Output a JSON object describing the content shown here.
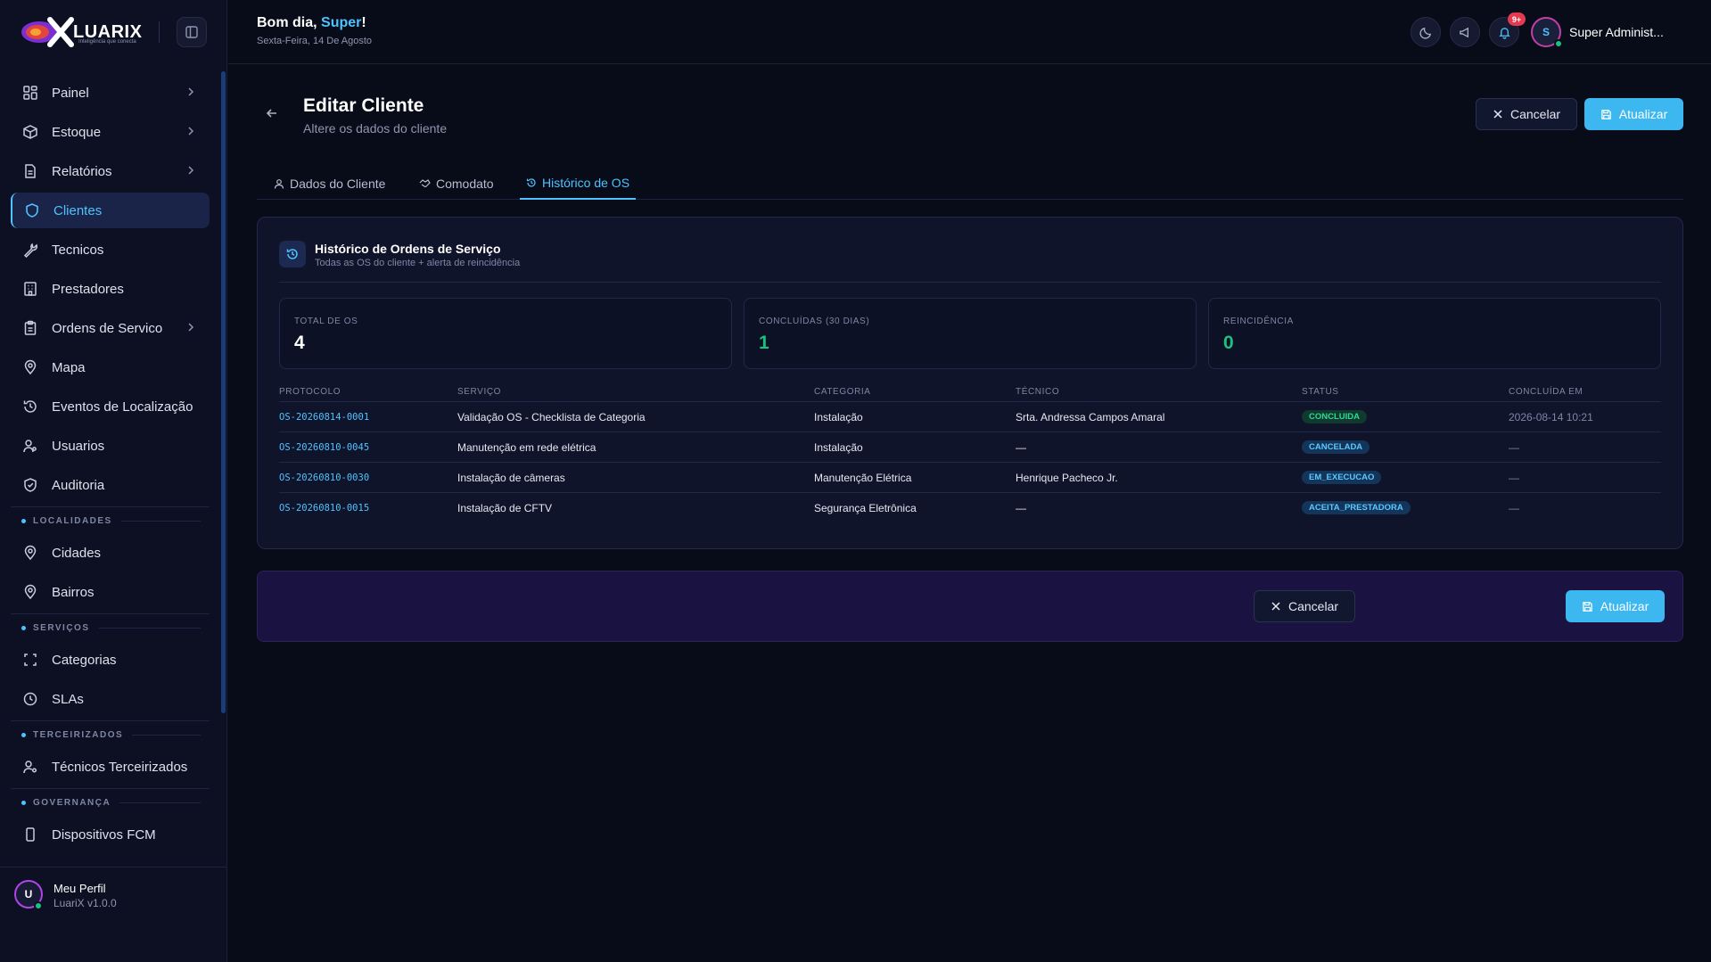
{
  "brand": {
    "logo_text": "LUARIX",
    "tagline": "Inteligência que conecta",
    "accent": "#4ec3ff"
  },
  "sidebar": {
    "items": [
      {
        "label": "Painel",
        "icon": "grid-icon",
        "chevron": true
      },
      {
        "label": "Estoque",
        "icon": "box-icon",
        "chevron": true
      },
      {
        "label": "Relatórios",
        "icon": "report-icon",
        "chevron": true
      },
      {
        "label": "Clientes",
        "icon": "shield-icon",
        "active": true
      },
      {
        "label": "Tecnicos",
        "icon": "wrench-icon"
      },
      {
        "label": "Prestadores",
        "icon": "building-icon"
      },
      {
        "label": "Ordens de Servico",
        "icon": "clipboard-icon",
        "chevron": true
      },
      {
        "label": "Mapa",
        "icon": "map-pin-icon"
      },
      {
        "label": "Eventos de Localização",
        "icon": "history-icon"
      },
      {
        "label": "Usuarios",
        "icon": "users-icon"
      },
      {
        "label": "Auditoria",
        "icon": "shield-check-icon"
      }
    ],
    "sections": [
      {
        "title": "LOCALIDADES",
        "items": [
          {
            "label": "Cidades",
            "icon": "map-pin-icon"
          },
          {
            "label": "Bairros",
            "icon": "map-pin-icon"
          }
        ]
      },
      {
        "title": "SERVIÇOS",
        "items": [
          {
            "label": "Categorias",
            "icon": "scan-icon"
          },
          {
            "label": "SLAs",
            "icon": "clock-icon"
          }
        ]
      },
      {
        "title": "TERCEIRIZADOS",
        "items": [
          {
            "label": "Técnicos Terceirizados",
            "icon": "user-cog-icon"
          }
        ]
      },
      {
        "title": "GOVERNANÇA",
        "items": [
          {
            "label": "Dispositivos FCM",
            "icon": "phone-icon"
          }
        ]
      }
    ],
    "profile": {
      "initial": "U",
      "name": "Meu Perfil",
      "version": "LuariX v1.0.0"
    }
  },
  "header": {
    "greeting_prefix": "Bom dia, ",
    "greeting_name": "Super",
    "greeting_suffix": "!",
    "date": "Sexta-Feira, 14 De Agosto",
    "notif_count": "9+",
    "user_initial": "S",
    "user_name": "Super Administ..."
  },
  "page": {
    "title": "Editar Cliente",
    "subtitle": "Altere os dados do cliente",
    "cancel_label": "Cancelar",
    "update_label": "Atualizar",
    "tabs": [
      {
        "label": "Dados do Cliente",
        "icon": "user-icon"
      },
      {
        "label": "Comodato",
        "icon": "handshake-icon"
      },
      {
        "label": "Histórico de OS",
        "icon": "history-icon",
        "active": true
      }
    ]
  },
  "history": {
    "title": "Histórico de Ordens de Serviço",
    "subtitle": "Todas as OS do cliente + alerta de reincidência",
    "stats": [
      {
        "label": "TOTAL DE OS",
        "value": "4",
        "color": "#ffffff"
      },
      {
        "label": "CONCLUÍDAS (30 DIAS)",
        "value": "1",
        "color": "#19c37d"
      },
      {
        "label": "REINCIDÊNCIA",
        "value": "0",
        "color": "#19c37d"
      }
    ],
    "columns": [
      "PROTOCOLO",
      "SERVIÇO",
      "CATEGORIA",
      "TÉCNICO",
      "STATUS",
      "CONCLUÍDA EM"
    ],
    "rows": [
      {
        "protocol": "OS-20260814-0001",
        "service": "Validação OS - Checklista de Categoria",
        "category": "Instalação",
        "technician": "Srta. Andressa Campos Amaral",
        "status": "CONCLUIDA",
        "status_bg": "#0f3a2d",
        "status_fg": "#2fd894",
        "completed": "2026-08-14 10:21"
      },
      {
        "protocol": "OS-20260810-0045",
        "service": "Manutenção em rede elétrica",
        "category": "Instalação",
        "technician": "—",
        "status": "CANCELADA",
        "status_bg": "#13355a",
        "status_fg": "#5cc8ff",
        "completed": "—"
      },
      {
        "protocol": "OS-20260810-0030",
        "service": "Instalação de câmeras",
        "category": "Manutenção Elétrica",
        "technician": "Henrique Pacheco Jr.",
        "status": "EM_EXECUCAO",
        "status_bg": "#13355a",
        "status_fg": "#5cc8ff",
        "completed": "—"
      },
      {
        "protocol": "OS-20260810-0015",
        "service": "Instalação de CFTV",
        "category": "Segurança Eletrônica",
        "technician": "—",
        "status": "ACEITA_PRESTADORA",
        "status_bg": "#13355a",
        "status_fg": "#5cc8ff",
        "completed": "—"
      }
    ]
  },
  "footer": {
    "cancel_label": "Cancelar",
    "update_label": "Atualizar"
  }
}
